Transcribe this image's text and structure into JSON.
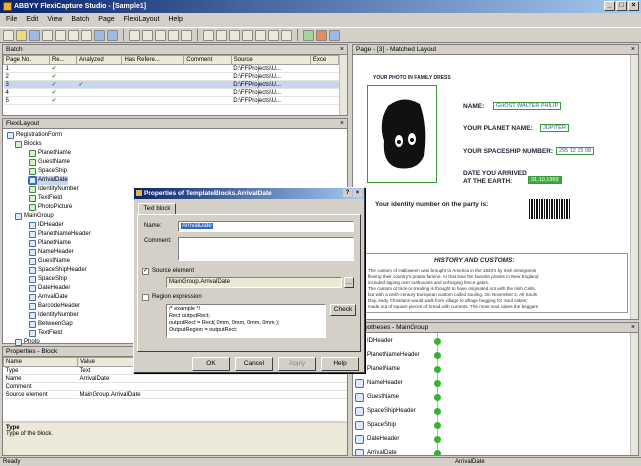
{
  "window": {
    "title": "ABBYY FlexiCapture Studio - [Sample1]"
  },
  "menu": [
    "File",
    "Edit",
    "View",
    "Batch",
    "Page",
    "FlexiLayout",
    "Help"
  ],
  "batch": {
    "title": "Batch",
    "columns": [
      "Page No.",
      "Re...",
      "Analyzed",
      "Has Refere...",
      "Comment",
      "Source",
      "Exce"
    ],
    "rows": [
      {
        "page": "1",
        "re": "✓",
        "analyzed": "",
        "source": "D:\\FFProjects\\U..."
      },
      {
        "page": "2",
        "re": "✓",
        "analyzed": "",
        "source": "D:\\FFProjects\\U..."
      },
      {
        "page": "3",
        "re": "✓",
        "analyzed": "✓",
        "source": "D:\\FFProjects\\U..."
      },
      {
        "page": "4",
        "re": "✓",
        "analyzed": "",
        "source": "D:\\FFProjects\\U..."
      },
      {
        "page": "5",
        "re": "✓",
        "analyzed": "",
        "source": "D:\\FFProjects\\U..."
      }
    ]
  },
  "flexilayout": {
    "title": "FlexiLayout",
    "items": [
      {
        "label": "RegistrationForm",
        "depth": 0
      },
      {
        "label": "Blocks",
        "depth": 1
      },
      {
        "label": "PlanetName",
        "depth": 2
      },
      {
        "label": "GuestName",
        "depth": 2
      },
      {
        "label": "SpaceShip",
        "depth": 2
      },
      {
        "label": "ArrivalDate",
        "depth": 2
      },
      {
        "label": "IdentityNumber",
        "depth": 2
      },
      {
        "label": "TextField",
        "depth": 2
      },
      {
        "label": "PhotoPicture",
        "depth": 2
      },
      {
        "label": "MainGroup",
        "depth": 1
      },
      {
        "label": "IDHeader",
        "depth": 2
      },
      {
        "label": "PlanetNameHeader",
        "depth": 2
      },
      {
        "label": "PlanetName",
        "depth": 2
      },
      {
        "label": "NameHeader",
        "depth": 2
      },
      {
        "label": "GuestName",
        "depth": 2
      },
      {
        "label": "SpaceShipHeader",
        "depth": 2
      },
      {
        "label": "SpaceShip",
        "depth": 2
      },
      {
        "label": "DateHeader",
        "depth": 2
      },
      {
        "label": "ArrivalDate",
        "depth": 2
      },
      {
        "label": "BarcodeHeader",
        "depth": 2
      },
      {
        "label": "IdentityNumber",
        "depth": 2
      },
      {
        "label": "BetweenGap",
        "depth": 2
      },
      {
        "label": "TextField",
        "depth": 2
      },
      {
        "label": "Photo",
        "depth": 1
      }
    ]
  },
  "properties": {
    "title": "Properties - Block",
    "columns": [
      "Name",
      "Value"
    ],
    "rows": [
      {
        "name": "Type",
        "value": "Text"
      },
      {
        "name": "Name",
        "value": "ArrivalDate"
      },
      {
        "name": "Comment",
        "value": ""
      },
      {
        "name": "Source element",
        "value": "MainGroup.ArrivalDate"
      }
    ],
    "desc_title": "Type",
    "desc_text": "Type of the block."
  },
  "dialog": {
    "title": "Properties of TemplateBlocks.ArrivalDate",
    "tab": "Text block",
    "name_label": "Name:",
    "name_value": "ArrivalDate",
    "comment_label": "Comment:",
    "source_label": "Source element",
    "source_value": "MainGroup.ArrivalDate",
    "region_label": "Region expression",
    "code": [
      "/* example */",
      "Rect outputRect;",
      "outputRect = Rect( 0mm, 0mm, 0mm, 0mm );",
      "OutputRegion = outputRect;"
    ],
    "check": "Check",
    "ok": "OK",
    "cancel": "Cancel",
    "apply": "Apply",
    "help": "Help"
  },
  "page": {
    "title": "Page - [3] - Matched Layout",
    "photo_label": "YOUR PHOTO IN FAMILY DRESS",
    "name_label": "NAME:",
    "name_value": "GHOST WALTER PHILIP",
    "planet_label": "YOUR PLANET NAME:",
    "planet_value": "JUPITER",
    "ship_label": "YOUR SPACESHIP NUMBER:",
    "ship_value": "295 12 15 08",
    "date_label1": "DATE YOU ARRIVED",
    "date_label2": "AT THE EARTH:",
    "date_value": "31.10.1999",
    "identity_label": "Your identity number on the party is:",
    "history_title": "HISTORY AND CUSTOMS:",
    "history_lines": [
      "The custom of Halloween was brought to America in the 1840's by Irish immigrants",
      "fleeing their country's potato famine. At that time the favorite pranks in New England",
      "included tipping over outhouses and unhinging fence gates.",
      "The custom of trick-or-treating is thought to have originated not with the Irish Celts,",
      "but with a ninth-century European custom called souling. On November 2, All Souls",
      "Day, early Christians would walk from village to village begging for 'soul cakes,'",
      "made out of square pieces of bread with currants. The more soul cakes the beggars"
    ]
  },
  "hypotheses": {
    "title": "Hypotheses - MainGroup",
    "items": [
      "IDHeader",
      "PlanetNameHeader",
      "PlanetName",
      "NameHeader",
      "GuestName",
      "SpaceShipHeader",
      "SpaceShip",
      "DateHeader",
      "ArrivalDate"
    ]
  },
  "status": {
    "left": "Ready",
    "right": "ArrivalDate"
  }
}
